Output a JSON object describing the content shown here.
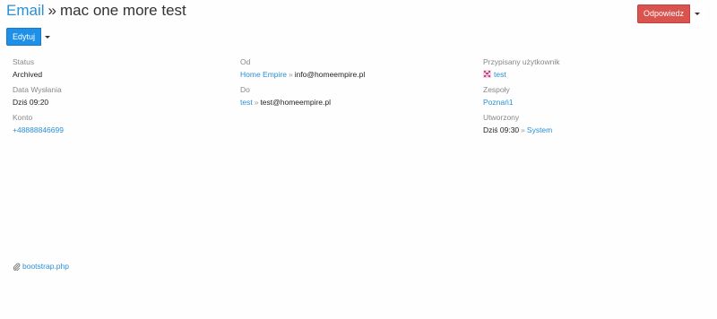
{
  "header": {
    "breadcrumb_link": "Email",
    "separator": "»",
    "title": "mac one more test"
  },
  "actions": {
    "reply_label": "Odpowiedz",
    "edit_label": "Edytuj"
  },
  "details": {
    "status": {
      "label": "Status",
      "value": "Archived"
    },
    "sent_date": {
      "label": "Data Wysłania",
      "value": "Dziś 09:20"
    },
    "account": {
      "label": "Konto",
      "value": "+48888846699"
    },
    "from": {
      "label": "Od",
      "name": "Home Empire",
      "arrow": "»",
      "email": "info@homeempire.pl"
    },
    "to": {
      "label": "Do",
      "name": "test",
      "arrow": "»",
      "email": "test@homeempire.pl"
    },
    "assigned_user": {
      "label": "Przypisany użytkownik",
      "value": "test"
    },
    "teams": {
      "label": "Zespoły",
      "value": "Poznań1"
    },
    "created": {
      "label": "Utworzony",
      "date": "Dziś 09:30",
      "arrow": "»",
      "by": "System"
    }
  },
  "attachment": {
    "filename": "bootstrap.php"
  },
  "colors": {
    "link": "#2a8fd6",
    "reply_button": "#d9534f",
    "edit_button": "#1e90e8",
    "label_text": "#888888"
  },
  "icons": {
    "assigned_user": "user-avatar-icon",
    "attachment": "paperclip-icon",
    "dropdown": "chevron-down-icon"
  }
}
